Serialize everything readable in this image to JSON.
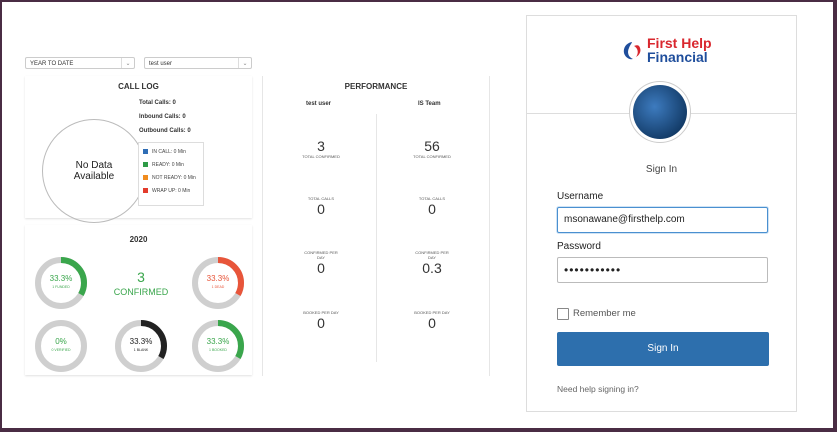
{
  "filters": {
    "period": "YEAR TO DATE",
    "user": "test user"
  },
  "call_log": {
    "title": "CALL LOG",
    "total_calls": "Total Calls: 0",
    "inbound_calls": "Inbound Calls: 0",
    "outbound_calls": "Outbound Calls: 0",
    "no_data_line1": "No Data",
    "no_data_line2": "Available",
    "legend": [
      {
        "label": "IN CALL: 0 Min",
        "color": "#2f6db5"
      },
      {
        "label": "READY: 0 Min",
        "color": "#2e9b47"
      },
      {
        "label": "NOT READY: 0 Min",
        "color": "#f08c1e"
      },
      {
        "label": "WRAP UP: 0 Min",
        "color": "#e33b2c"
      }
    ]
  },
  "year_panel": {
    "title": "2020",
    "confirmed_value": "3",
    "confirmed_label": "CONFIRMED",
    "donuts": [
      {
        "value": "33.3%",
        "label": "1 FUNDED",
        "color": "#3aa64c",
        "fraction": 0.333
      },
      {
        "value": "33.3%",
        "label": "1 DEAD",
        "color": "#e8553a",
        "fraction": 0.333
      },
      {
        "value": "0%",
        "label": "0 VERIFIED",
        "color": "#3aa64c",
        "fraction": 0
      },
      {
        "value": "33.3%",
        "label": "1 BLANK",
        "color": "#222222",
        "fraction": 0.333
      },
      {
        "value": "33.3%",
        "label": "1 BOOKED",
        "color": "#3aa64c",
        "fraction": 0.333
      }
    ]
  },
  "performance": {
    "title": "PERFORMANCE",
    "col1": "test user",
    "col2": "IS Team",
    "rows": [
      {
        "label1": "TOTAL CONFIRMED",
        "value1": "3",
        "label2": "TOTAL CONFIRMED",
        "value2": "56"
      },
      {
        "label1": "TOTAL CALLS",
        "value1": "0",
        "label2": "TOTAL CALLS",
        "value2": "0"
      },
      {
        "label1": "CONFIRMED PER DAY",
        "value1": "0",
        "label2": "CONFIRMED PER DAY",
        "value2": "0.3"
      },
      {
        "label1": "BOOKED PER DAY",
        "value1": "0",
        "label2": "BOOKED PER DAY",
        "value2": "0"
      }
    ]
  },
  "login": {
    "brand_line1": "First Help",
    "brand_line2": "Financial",
    "heading": "Sign In",
    "username_label": "Username",
    "username_value": "msonawane@firsthelp.com",
    "password_label": "Password",
    "password_value": "•••••••••••",
    "remember_label": "Remember me",
    "submit_label": "Sign In",
    "help_link": "Need help signing in?",
    "brand_color_red": "#d9272e",
    "brand_color_blue": "#1f4e9c",
    "button_color": "#2d6fad"
  }
}
